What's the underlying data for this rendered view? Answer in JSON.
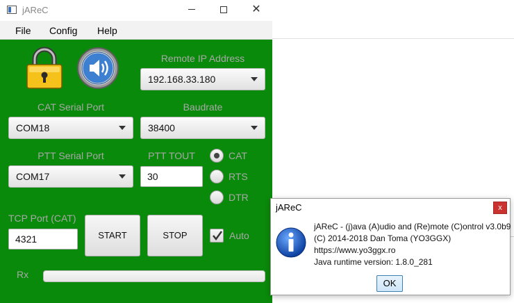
{
  "window": {
    "title": "jAReC",
    "minimize_glyph": "",
    "close_glyph": "✕"
  },
  "menu": {
    "items": [
      "File",
      "Config",
      "Help"
    ]
  },
  "icons": {
    "lock": "padlock-icon",
    "speaker": "speaker-icon"
  },
  "remote_ip": {
    "label": "Remote IP Address",
    "value": "192.168.33.180"
  },
  "cat_port": {
    "label": "CAT Serial Port",
    "value": "COM18"
  },
  "baudrate": {
    "label": "Baudrate",
    "value": "38400"
  },
  "ptt_port": {
    "label": "PTT Serial Port",
    "value": "COM17"
  },
  "ptt_tout": {
    "label": "PTT TOUT",
    "value": "30"
  },
  "radios": {
    "cat": "CAT",
    "rts": "RTS",
    "dtr": "DTR",
    "selected": "CAT"
  },
  "tcp_port": {
    "label": "TCP Port (CAT)",
    "value": "4321"
  },
  "buttons": {
    "start": "START",
    "stop": "STOP"
  },
  "auto": {
    "label": "Auto",
    "checked": true
  },
  "rx": {
    "label": "Rx",
    "level": 0
  },
  "colors": {
    "panel": "#0a8a0a",
    "label_gray": "#a8a8a8",
    "dialog_close": "#c9322f"
  },
  "dialog": {
    "title": "jAReC",
    "close_label": "x",
    "lines": [
      "jAReC - (j)ava (A)udio and (Re)mote (C)ontrol v3.0b9",
      "(C) 2014-2018 Dan Toma (YO3GGX)",
      "https://www.yo3ggx.ro",
      "Java runtime version: 1.8.0_281"
    ],
    "ok_label": "OK"
  }
}
